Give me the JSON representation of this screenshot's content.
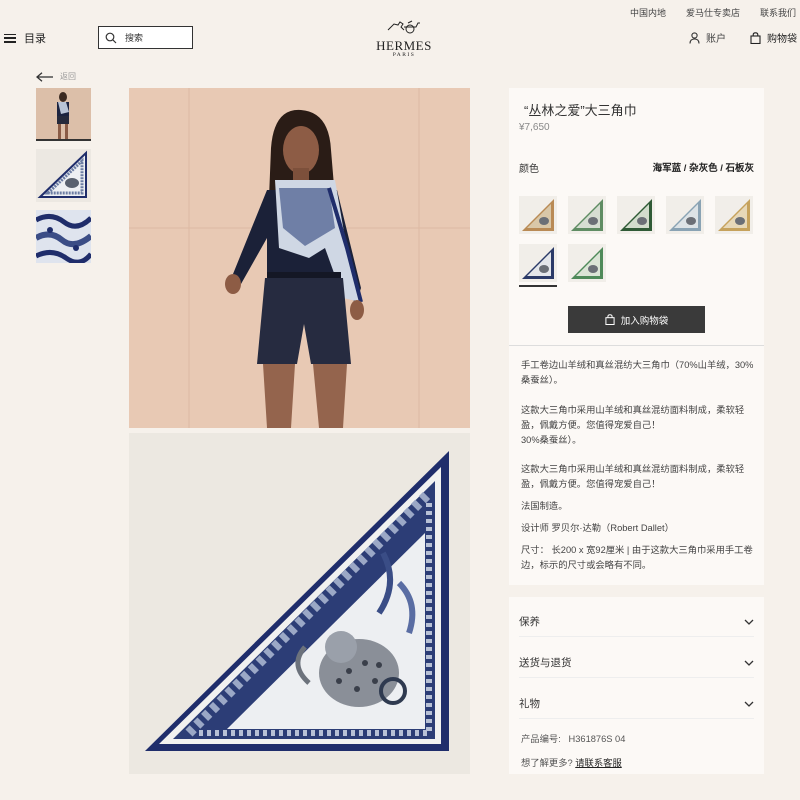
{
  "utility_links": [
    "中国内地",
    "爱马仕专卖店",
    "联系我们"
  ],
  "header": {
    "menu_label": "目录",
    "search_placeholder": "搜索",
    "logo_brand": "HERMES",
    "logo_city": "PARIS",
    "account_label": "账户",
    "bag_label": "购物袋"
  },
  "back_label": "返回",
  "product": {
    "title": "“丛林之爱”大三角巾",
    "price": "¥7,650",
    "color_label": "颜色",
    "color_value": "海军蓝 / 杂灰色 / 石板灰",
    "add_to_bag": "加入购物袋",
    "desc_1": "手工卷边山羊绒和真丝混纺大三角巾（70%山羊绒，30%桑蚕丝）。",
    "desc_2": "这款大三角巾采用山羊绒和真丝混纺面料制成，柔软轻盈，佩戴方便。您值得宠爱自己！",
    "desc_3": "30%桑蚕丝）。",
    "desc_4": "这款大三角巾采用山羊绒和真丝混纺面料制成，柔软轻盈，佩戴方便。您值得宠爱自己！",
    "desc_5": "法国制造。",
    "desc_6": "设计师 罗贝尔·达勒（Robert Dallet）",
    "desc_7": "尺寸： 长200 x 宽92厘米 | 由于这款大三角巾采用手工卷边，标示的尺寸或会略有不同。"
  },
  "swatches": [
    {
      "name": "swatch-1",
      "bg": "#d9c7a8",
      "band": "#b98a55"
    },
    {
      "name": "swatch-2",
      "bg": "#d6ddd2",
      "band": "#5f8c63"
    },
    {
      "name": "swatch-3",
      "bg": "#d2dccc",
      "band": "#2f5a36"
    },
    {
      "name": "swatch-4",
      "bg": "#dde3e6",
      "band": "#8aa3b4"
    },
    {
      "name": "swatch-5",
      "bg": "#e7d8b8",
      "band": "#c6a25c"
    },
    {
      "name": "swatch-6",
      "bg": "#e4e6ea",
      "band": "#2b3a68"
    },
    {
      "name": "swatch-7",
      "bg": "#dbe4d6",
      "band": "#4f8a5a"
    }
  ],
  "accordion": {
    "care": "保养",
    "shipping": "送货与退货",
    "gift": "礼物"
  },
  "meta": {
    "product_code_label": "产品编号:",
    "product_code": "H361876S 04",
    "contact_prompt": "想了解更多?",
    "contact_link": "请联系客服"
  },
  "colors": {
    "navy": "#1f2d6b",
    "button": "#3a3a3a",
    "background": "#f6f1eb",
    "panel": "#fcf9f6"
  }
}
